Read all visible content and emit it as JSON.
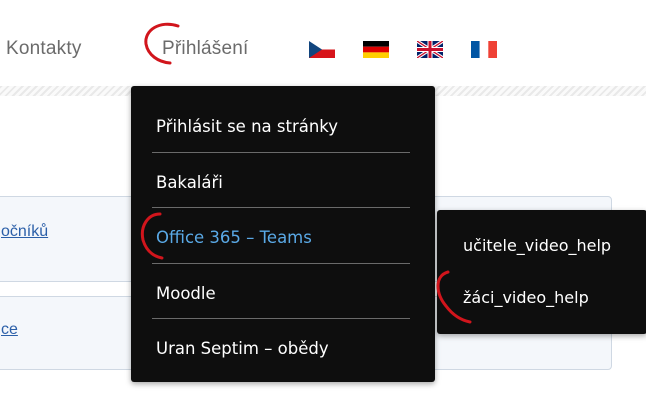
{
  "nav": {
    "contact_label": "Kontakty",
    "login_label": "Přihlášení"
  },
  "flags": [
    {
      "icon": "czech-flag-icon",
      "colors": [
        "#ffffff",
        "#d7141a",
        "#11457e"
      ]
    },
    {
      "icon": "german-flag-icon",
      "colors": [
        "#000000",
        "#dd0000",
        "#ffce00"
      ]
    },
    {
      "icon": "uk-flag-icon",
      "colors": [
        "#012169",
        "#ffffff",
        "#c8102e"
      ]
    },
    {
      "icon": "french-flag-icon",
      "colors": [
        "#0055a4",
        "#ffffff",
        "#ef4135"
      ]
    }
  ],
  "page": {
    "link_1": "očníků",
    "link_2": "ce"
  },
  "dropdown": {
    "items": [
      {
        "label": "Přihlásit se na stránky"
      },
      {
        "label": "Bakaláři"
      },
      {
        "label": "Office 365 – Teams",
        "active": true
      },
      {
        "label": "Moodle"
      },
      {
        "label": "Uran Septim – obědy"
      }
    ],
    "active_color": "#5aa9e6"
  },
  "submenu": {
    "items": [
      {
        "label": "učitele_video_help"
      },
      {
        "label": "žáci_video_help"
      }
    ]
  },
  "annotation_color": "#d1151c"
}
